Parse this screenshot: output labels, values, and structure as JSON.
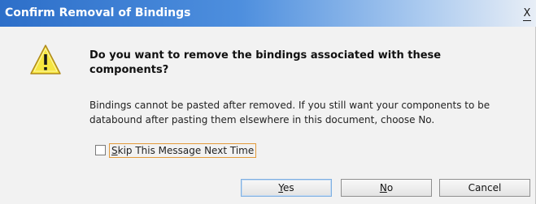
{
  "window": {
    "title": "Confirm Removal of Bindings",
    "close_label": "X"
  },
  "icon": {
    "name": "warning-icon",
    "glyph": "!",
    "fill_color": "#f6e640",
    "outline_color": "#b08a1c"
  },
  "message": {
    "heading": "Do you want to remove the bindings associated with these components?",
    "body": "Bindings cannot be pasted after removed. If you still want your components to be databound after pasting them elsewhere in this document, choose No."
  },
  "checkbox": {
    "label_mnemonic": "S",
    "label_rest": "kip This Message Next Time",
    "checked": false
  },
  "buttons": {
    "yes": {
      "mnemonic": "Y",
      "rest": "es"
    },
    "no": {
      "mnemonic": "N",
      "rest": "o"
    },
    "cancel": {
      "label": "Cancel"
    }
  },
  "colors": {
    "title_bar_start": "#2d6fc9",
    "title_bar_end": "#e8eef6",
    "dialog_background": "#f2f2f2",
    "focus_outline": "#e29a3b",
    "default_button_border": "#7fb0e2"
  }
}
